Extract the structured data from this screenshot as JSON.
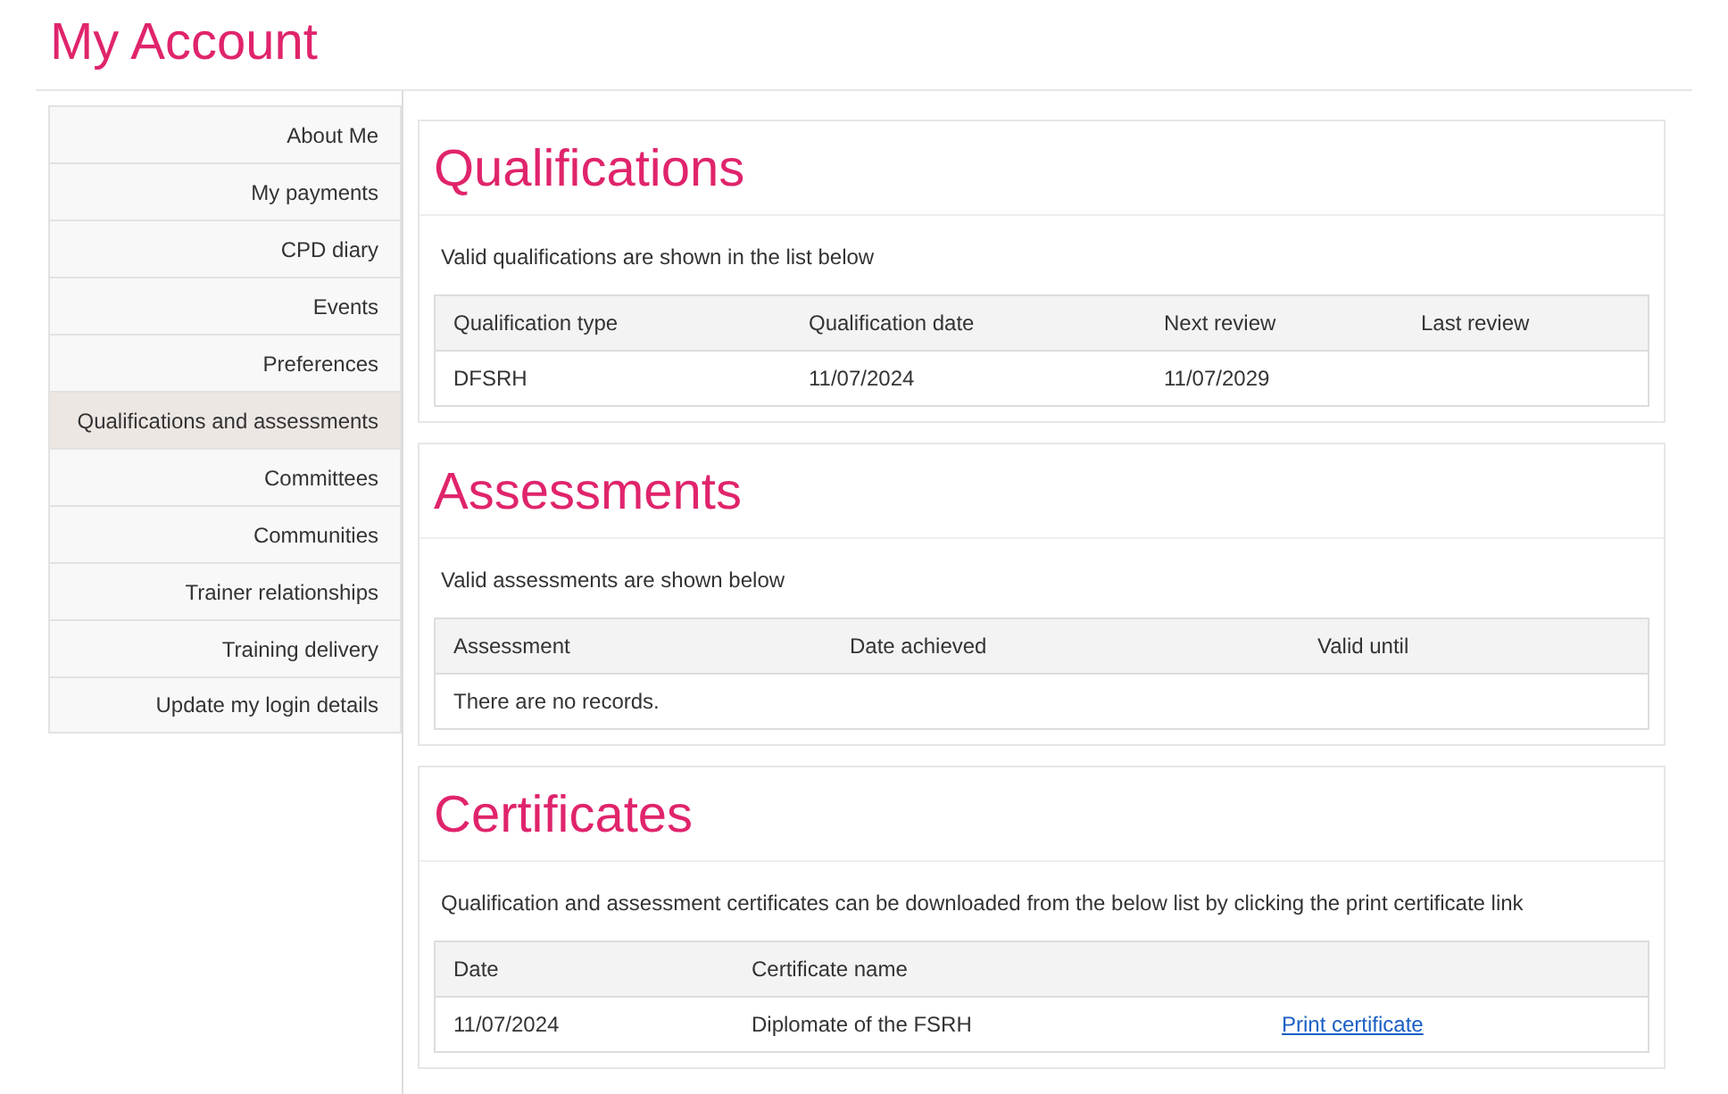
{
  "page_title": "My Account",
  "sidebar": {
    "items": [
      {
        "label": "About Me",
        "selected": false
      },
      {
        "label": "My payments",
        "selected": false
      },
      {
        "label": "CPD diary",
        "selected": false
      },
      {
        "label": "Events",
        "selected": false
      },
      {
        "label": "Preferences",
        "selected": false
      },
      {
        "label": "Qualifications and assessments",
        "selected": true
      },
      {
        "label": "Committees",
        "selected": false
      },
      {
        "label": "Communities",
        "selected": false
      },
      {
        "label": "Trainer relationships",
        "selected": false
      },
      {
        "label": "Training delivery",
        "selected": false
      },
      {
        "label": "Update my login details",
        "selected": false
      }
    ]
  },
  "sections": [
    {
      "title": "Qualifications",
      "description": "Valid qualifications are shown in the list below",
      "columns": [
        "Qualification type",
        "Qualification date",
        "Next review",
        "Last review"
      ],
      "rows": [
        [
          {
            "kind": "text",
            "text": "DFSRH"
          },
          {
            "kind": "text",
            "text": "11/07/2024"
          },
          {
            "kind": "text",
            "text": "11/07/2029"
          }
        ]
      ]
    },
    {
      "title": "Assessments",
      "description": "Valid assessments are shown below",
      "columns": [
        "Assessment",
        "Date achieved",
        "Valid until"
      ],
      "empty_message": "There are no records."
    },
    {
      "title": "Certificates",
      "description": "Qualification and assessment certificates can be downloaded from the below list by clicking the print certificate link",
      "columns": [
        "Date",
        "Certificate name"
      ],
      "rows": [
        [
          {
            "kind": "text",
            "text": "11/07/2024"
          },
          {
            "kind": "text",
            "text": "Diplomate of the FSRH"
          },
          {
            "kind": "link",
            "text": "Print certificate"
          }
        ]
      ]
    }
  ]
}
